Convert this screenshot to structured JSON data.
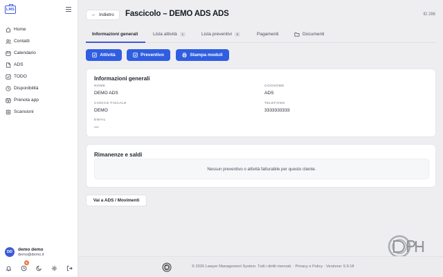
{
  "app": {
    "logo_text": "LMS"
  },
  "sidebar": {
    "items": [
      {
        "label": "Home",
        "icon": "home-icon"
      },
      {
        "label": "Contatti",
        "icon": "users-icon"
      },
      {
        "label": "Calendario",
        "icon": "calendar-icon"
      },
      {
        "label": "ADS",
        "icon": "file-icon"
      },
      {
        "label": "TODO",
        "icon": "checkbox-icon"
      },
      {
        "label": "Disponibilità",
        "icon": "clock-icon"
      },
      {
        "label": "Prenota app",
        "icon": "calendar-plus-icon"
      },
      {
        "label": "Scansioni",
        "icon": "scan-icon"
      }
    ]
  },
  "user": {
    "initials": "DD",
    "name": "demo demo",
    "email": "demo@demo.it",
    "notification_count": "6"
  },
  "header": {
    "back_label": "Indietro",
    "title": "Fascicolo – DEMO ADS ADS",
    "id_label": "ID 286"
  },
  "tabs": [
    {
      "label": "Informazioni generali",
      "active": true
    },
    {
      "label": "Lista attività",
      "count": "1"
    },
    {
      "label": "Lista preventivi",
      "count": "0"
    },
    {
      "label": "Pagamenti"
    },
    {
      "label": "Documenti",
      "icon": "folder-icon"
    }
  ],
  "actions": {
    "activity": "Attività",
    "quote": "Preventivo",
    "print": "Stampa moduli"
  },
  "general_info": {
    "title": "Informazioni generali",
    "nome_label": "NOME",
    "nome_value": "DEMO ADS",
    "cognome_label": "COGNOME",
    "cognome_value": "ADS",
    "cf_label": "CODICE FISCALE",
    "cf_value": "DEMO",
    "telefono_label": "TELEFONO",
    "telefono_value": "3333333333",
    "email_label": "EMAIL",
    "email_value": "—"
  },
  "balances": {
    "title": "Rimanenze e saldi",
    "empty_message": "Nessun preventivo o attività fatturabile per questo cliente."
  },
  "link_button": "Vai a ADS / Movimenti",
  "footer": {
    "text": "© 2026 Lawyer Management System. Tutti i diritti riservati. · Privacy e Policy · Versione: 5.9.18"
  },
  "colors": {
    "accent": "#2f5ee0",
    "badge": "#e8743a"
  }
}
